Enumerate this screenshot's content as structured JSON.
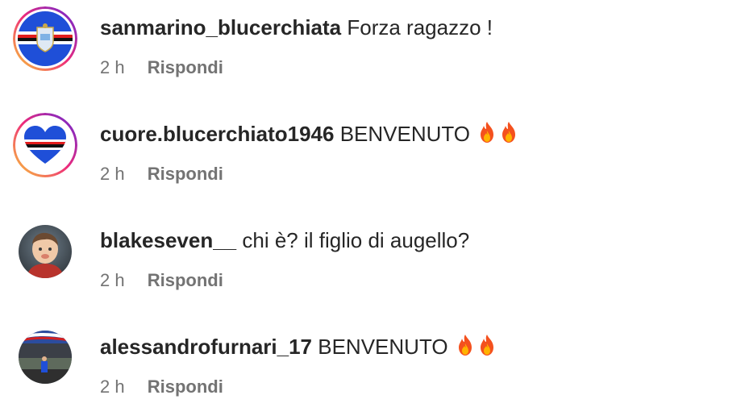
{
  "comments": [
    {
      "username": "sanmarino_blucerchiata",
      "text": "Forza ragazzo !",
      "emojis": [],
      "time": "2 h",
      "reply_label": "Rispondi",
      "avatar_icon": "sampdoria-crest-icon"
    },
    {
      "username": "cuore.blucerchiato1946",
      "text": "BENVENUTO",
      "emojis": [
        "fire-icon",
        "fire-icon"
      ],
      "time": "2 h",
      "reply_label": "Rispondi",
      "avatar_icon": "blucerchiato-heart-icon"
    },
    {
      "username": "blakeseven__",
      "text": "chi è? il figlio di augello?",
      "emojis": [],
      "time": "2 h",
      "reply_label": "Rispondi",
      "avatar_icon": "child-photo-avatar"
    },
    {
      "username": "alessandrofurnari_17",
      "text": "BENVENUTO",
      "emojis": [
        "fire-icon",
        "fire-icon"
      ],
      "time": "2 h",
      "reply_label": "Rispondi",
      "avatar_icon": "stadium-photo-avatar"
    }
  ],
  "colors": {
    "text": "#262626",
    "secondary": "#737373",
    "story_ring_start": "#f9ce34",
    "story_ring_mid": "#ee2a7b",
    "story_ring_end": "#6228d7",
    "samp_blue": "#1f4fd8"
  }
}
